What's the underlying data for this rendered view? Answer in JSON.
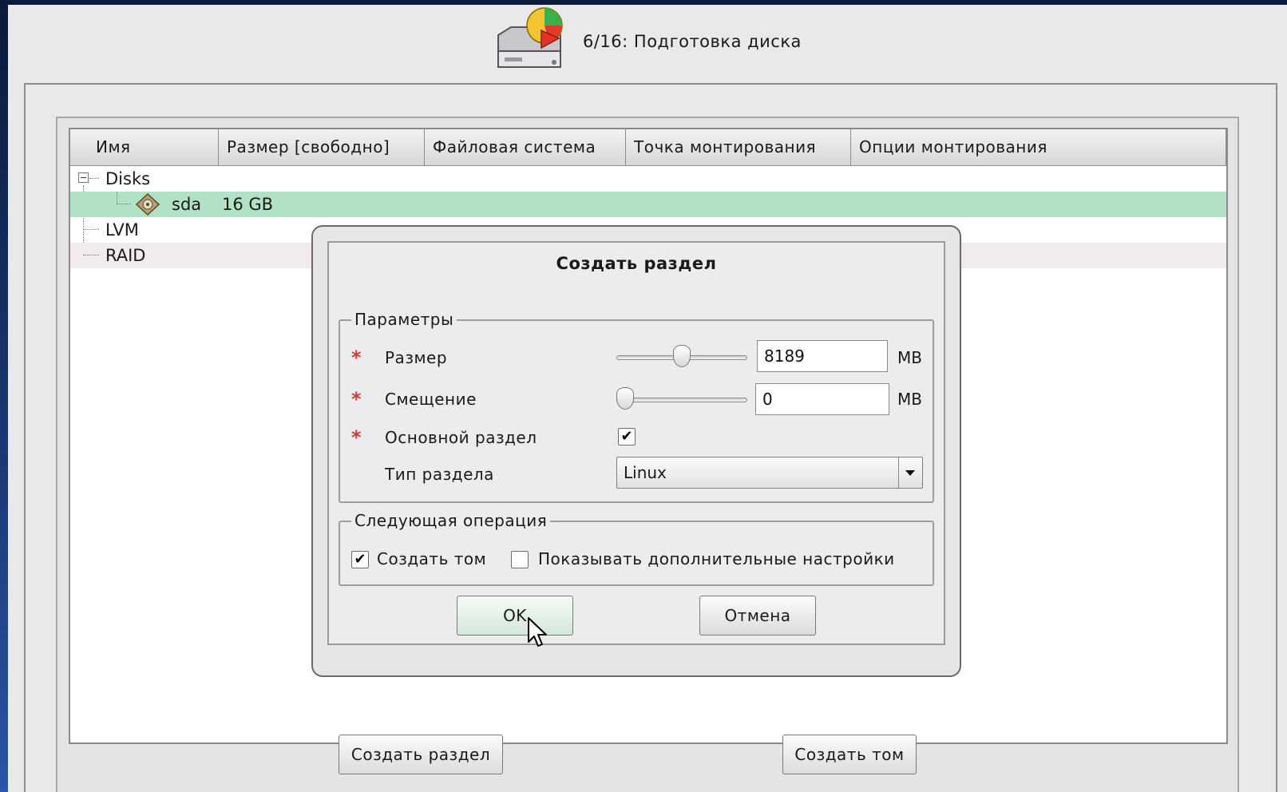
{
  "header": {
    "step_title": "6/16: Подготовка диска",
    "icon": "disk-partition-icon"
  },
  "tree": {
    "columns": [
      "Имя",
      "Размер [свободно]",
      "Файловая система",
      "Точка монтирования",
      "Опции монтирования"
    ],
    "rows": {
      "disks": {
        "name": "Disks"
      },
      "sda": {
        "name": "sda",
        "size": "16 GB",
        "icon": "hard-disk-icon"
      },
      "lvm": {
        "name": "LVM"
      },
      "raid": {
        "name": "RAID"
      }
    }
  },
  "buttons": {
    "create_partition": "Создать раздел",
    "create_volume": "Создать том"
  },
  "dialog": {
    "title": "Создать раздел",
    "params_group": "Параметры",
    "size_label": "Размер",
    "size_value": "8189",
    "size_unit": "MB",
    "size_slider_fraction": 0.5,
    "offset_label": "Смещение",
    "offset_value": "0",
    "offset_unit": "MB",
    "offset_slider_fraction": 0.0,
    "primary_label": "Основной раздел",
    "primary_checked": true,
    "type_label": "Тип раздела",
    "type_value": "Linux",
    "next_group": "Следующая операция",
    "create_volume_label": "Создать том",
    "create_volume_checked": true,
    "show_advanced_label": "Показывать дополнительные настройки",
    "show_advanced_checked": false,
    "ok_label": "OK",
    "cancel_label": "Отмена",
    "required_mark": "*",
    "colors": {
      "required": "#d23a3a",
      "selected_row": "#b2e2c6"
    }
  }
}
